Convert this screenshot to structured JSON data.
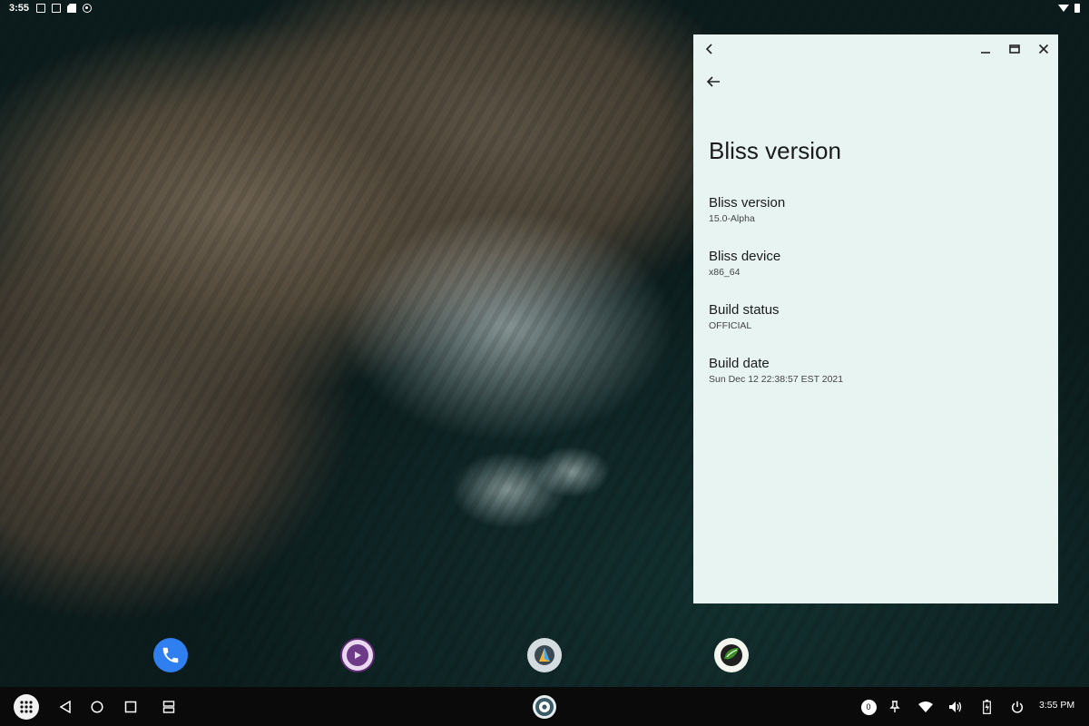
{
  "status_bar": {
    "time": "3:55",
    "icons": [
      "save-icon",
      "save-icon",
      "sd-card-icon",
      "record-icon"
    ],
    "right_icons": [
      "wifi-icon",
      "battery-icon"
    ]
  },
  "window": {
    "background": "#e7f4f2",
    "caption_buttons": [
      "collapse-icon",
      "minimize-icon",
      "maximize-icon",
      "close-icon"
    ],
    "page_title": "Bliss version",
    "items": [
      {
        "title": "Bliss version",
        "summary": "15.0-Alpha"
      },
      {
        "title": "Bliss device",
        "summary": "x86_64"
      },
      {
        "title": "Build status",
        "summary": "OFFICIAL"
      },
      {
        "title": "Build date",
        "summary": "Sun Dec 12 22:38:57 EST 2021"
      }
    ]
  },
  "dock": [
    {
      "name": "phone-app-icon",
      "color": "#2f7ff0"
    },
    {
      "name": "music-app-icon",
      "color": "#6d3a87"
    },
    {
      "name": "files-app-icon",
      "color": "#f2b233"
    },
    {
      "name": "sprout-app-icon",
      "color": "#3c8c2a"
    }
  ],
  "taskbar": {
    "notification_count": "0",
    "clock": "3:55 PM",
    "buttons": [
      "app-drawer-icon",
      "back-icon",
      "home-icon",
      "recents-icon",
      "split-screen-icon",
      "settings-icon",
      "pin-icon",
      "wifi-icon",
      "volume-icon",
      "battery-icon",
      "power-icon"
    ]
  }
}
